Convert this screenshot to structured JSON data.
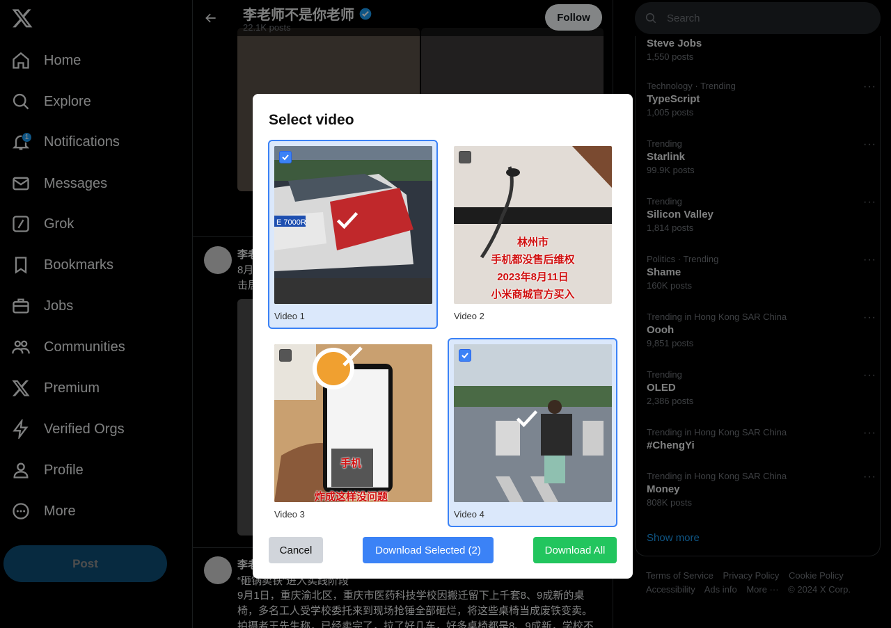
{
  "sidebar": {
    "items": [
      {
        "label": "Home",
        "icon": "home-icon"
      },
      {
        "label": "Explore",
        "icon": "search-icon"
      },
      {
        "label": "Notifications",
        "icon": "bell-icon",
        "badge": "1"
      },
      {
        "label": "Messages",
        "icon": "envelope-icon"
      },
      {
        "label": "Grok",
        "icon": "grok-icon"
      },
      {
        "label": "Bookmarks",
        "icon": "bookmark-icon"
      },
      {
        "label": "Jobs",
        "icon": "briefcase-icon"
      },
      {
        "label": "Communities",
        "icon": "people-icon"
      },
      {
        "label": "Premium",
        "icon": "x-logo-icon"
      },
      {
        "label": "Verified Orgs",
        "icon": "lightning-icon"
      },
      {
        "label": "Profile",
        "icon": "person-icon"
      },
      {
        "label": "More",
        "icon": "more-circle-icon"
      }
    ],
    "post_button": "Post"
  },
  "profile": {
    "name": "李老师不是你老师",
    "posts": "22.1K posts",
    "follow_label": "Follow"
  },
  "timeline": {
    "tweet2_name": "李老",
    "tweet2_line1": "8月",
    "tweet2_line2": "击居",
    "tweet3_name": "李老",
    "tweet3_quote": "“砸锅卖铁”进入实践阶段",
    "tweet3_text": "9月1日，重庆渝北区，重庆市医药科技学校因搬迁留下上千套8、9成新的桌椅，多名工人受学校委托来到现场抢锤全部砸烂，将这些桌椅当成废铁变卖。拍摄者王先生称，已经卖完了，拉了好几车，好多桌椅都是8、9成新，学校不"
  },
  "search": {
    "placeholder": "Search"
  },
  "trends": [
    {
      "context": "",
      "name": "Steve Jobs",
      "count": "1,550 posts"
    },
    {
      "context": "Technology · Trending",
      "name": "TypeScript",
      "count": "1,005 posts"
    },
    {
      "context": "Trending",
      "name": "Starlink",
      "count": "99.9K posts"
    },
    {
      "context": "Trending",
      "name": "Silicon Valley",
      "count": "1,814 posts"
    },
    {
      "context": "Politics · Trending",
      "name": "Shame",
      "count": "160K posts"
    },
    {
      "context": "Trending in Hong Kong SAR China",
      "name": "Oooh",
      "count": "9,851 posts"
    },
    {
      "context": "Trending",
      "name": "OLED",
      "count": "2,386 posts"
    },
    {
      "context": "Trending in Hong Kong SAR China",
      "name": "#ChengYi",
      "count": ""
    },
    {
      "context": "Trending in Hong Kong SAR China",
      "name": "Money",
      "count": "808K posts"
    }
  ],
  "show_more": "Show more",
  "footer": {
    "links": [
      "Terms of Service",
      "Privacy Policy",
      "Cookie Policy",
      "Accessibility",
      "Ads info",
      "More ···"
    ],
    "copyright": "© 2024 X Corp."
  },
  "modal": {
    "title": "Select video",
    "videos": [
      {
        "label": "Video 1",
        "selected": true,
        "plate": "E 7000R"
      },
      {
        "label": "Video 2",
        "selected": false,
        "caption": [
          "林州市",
          "手机都没售后维权",
          "2023年8月11日",
          "小米商城官方买入"
        ]
      },
      {
        "label": "Video 3",
        "selected": false,
        "caption": [
          "手机",
          "炸成这样没问题"
        ]
      },
      {
        "label": "Video 4",
        "selected": true
      }
    ],
    "cancel_label": "Cancel",
    "download_selected_label": "Download Selected (2)",
    "download_all_label": "Download All"
  },
  "colors": {
    "accent": "#1d9bf0",
    "selected_border": "#3b82f6",
    "download_all": "#22c55e"
  }
}
